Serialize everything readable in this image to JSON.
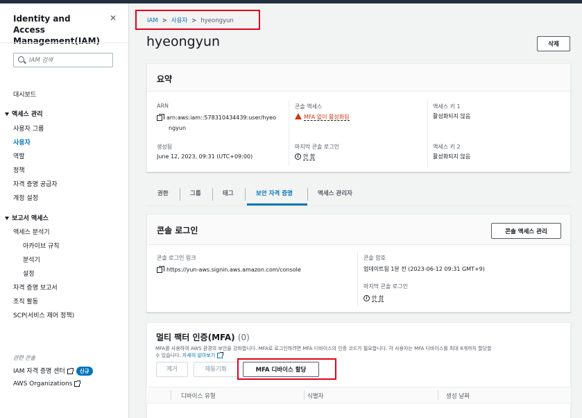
{
  "sidebar": {
    "title": "Identity and Access Management(IAM)",
    "search_placeholder": "IAM 검색",
    "dashboard": "대시보드",
    "access_mgmt": "액세스 관리",
    "access_items": [
      "사용자 그룹",
      "사용자",
      "역할",
      "정책",
      "자격 증명 공급자",
      "계정 설정"
    ],
    "reports": "보고서 액세스",
    "report_items": [
      "액세스 분석기",
      "아카이브 규칙",
      "분석기",
      "설정",
      "자격 증명 보고서",
      "조직 활동",
      "SCP(서비스 제어 정책)"
    ],
    "related": "관련 콘솔",
    "related_items": [
      "IAM 자격 증명 센터",
      "AWS Organizations"
    ],
    "new_badge": "신규"
  },
  "breadcrumb": {
    "iam": "IAM",
    "users": "사용자",
    "current": "hyeongyun"
  },
  "page": {
    "title": "hyeongyun",
    "delete_button": "삭제"
  },
  "summary": {
    "title": "요약",
    "arn_label": "ARN",
    "arn_line1": "arn:aws:iam::578310434439:user/hyeo",
    "arn_line2": "ngyun",
    "created_label": "생성됨",
    "created_value": "June 12, 2023, 09:31 (UTC+09:00)",
    "console_access_label": "콘솔 액세스",
    "console_access_value": "MFA 없이 활성화됨",
    "last_login_label": "마지막 콘솔 로그인",
    "last_login_value": "안 함",
    "key1_label": "액세스 키 1",
    "key1_value": "활성화되지 않음",
    "key2_label": "액세스 키 2",
    "key2_value": "활성화되지 않음"
  },
  "tabs": [
    "권한",
    "그룹",
    "태그",
    "보안 자격 증명",
    "액세스 관리자"
  ],
  "console_login": {
    "title": "콘솔 로그인",
    "manage_button": "콘솔 액세스 관리",
    "link_label": "콘솔 로그인 링크",
    "link_value": "https://yun-aws.signin.aws.amazon.com/console",
    "password_label": "콘솔 암호",
    "password_value": "업데이트됨 1분 전 (2023-06-12 09:31 GMT+9)",
    "last_login_label": "마지막 콘솔 로그인",
    "last_login_value": "안 함"
  },
  "mfa": {
    "title": "멀티 팩터 인증(MFA)",
    "count": "(0)",
    "desc_line1": "MFA를 사용하여 AWS 환경의 보안을 강화합니다. MFA로 로그인하려면 MFA 디바이스의 인증 코드가 필요합니다. 각 사용자는 MFA 디바이스를 최대 8개까지 할당할",
    "desc_line2": "수 있습니다.",
    "learn_more": "자세히 알아보기",
    "remove_button": "제거",
    "resync_button": "재동기화",
    "assign_button": "MFA 디바이스 할당",
    "columns": [
      "디바이스 유형",
      "식별자",
      "생성 날짜"
    ]
  },
  "colors": {
    "accent": "#0073bb",
    "warning": "#d13212",
    "highlight": "#e3001b"
  }
}
